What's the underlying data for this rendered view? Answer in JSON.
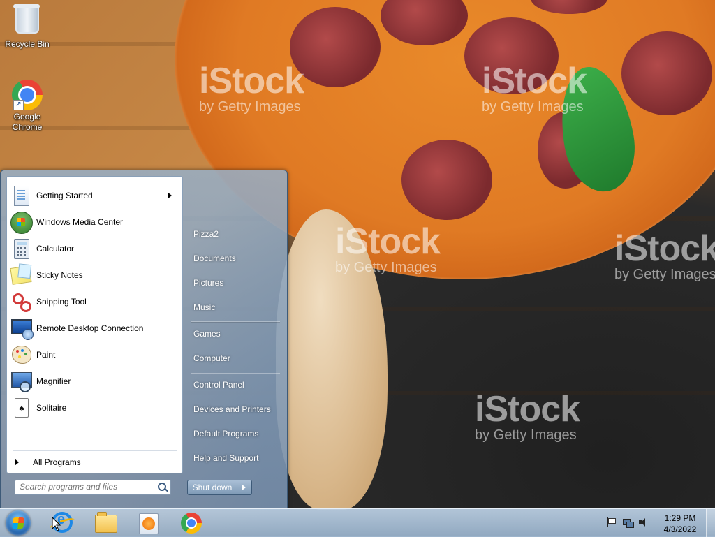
{
  "desktop": {
    "watermarks": [
      {
        "big": "iStock",
        "small": "by Getty Images"
      },
      {
        "big": "iStock",
        "small": "by Getty Images"
      },
      {
        "big": "iStock",
        "small": "by Getty Images"
      },
      {
        "big": "iStock",
        "small": "by Getty Images"
      },
      {
        "big": "iStock",
        "small": "by Getty Images"
      }
    ],
    "icons": [
      {
        "label": "Recycle Bin",
        "icon": "recycle-bin-icon"
      },
      {
        "label": "Google Chrome",
        "icon": "chrome-icon"
      }
    ]
  },
  "start_menu": {
    "programs": [
      {
        "label": "Getting Started",
        "icon": "getting-started-icon",
        "has_submenu": true
      },
      {
        "label": "Windows Media Center",
        "icon": "windows-media-center-icon"
      },
      {
        "label": "Calculator",
        "icon": "calculator-icon"
      },
      {
        "label": "Sticky Notes",
        "icon": "sticky-notes-icon"
      },
      {
        "label": "Snipping Tool",
        "icon": "snipping-tool-icon"
      },
      {
        "label": "Remote Desktop Connection",
        "icon": "remote-desktop-icon"
      },
      {
        "label": "Paint",
        "icon": "paint-icon"
      },
      {
        "label": "Magnifier",
        "icon": "magnifier-icon"
      },
      {
        "label": "Solitaire",
        "icon": "solitaire-icon"
      }
    ],
    "all_programs_label": "All Programs",
    "search_placeholder": "Search programs and files",
    "right_items": [
      "Pizza2",
      "Documents",
      "Pictures",
      "Music",
      "Games",
      "Computer",
      "Control Panel",
      "Devices and Printers",
      "Default Programs",
      "Help and Support"
    ],
    "shutdown_label": "Shut down"
  },
  "taskbar": {
    "pinned": [
      {
        "name": "Internet Explorer",
        "icon": "internet-explorer-icon"
      },
      {
        "name": "Windows Explorer",
        "icon": "folder-icon"
      },
      {
        "name": "Windows Media Player",
        "icon": "media-player-icon"
      },
      {
        "name": "Google Chrome",
        "icon": "chrome-icon"
      }
    ],
    "tray_icons": [
      "action-center-flag-icon",
      "network-icon",
      "volume-icon"
    ],
    "clock": {
      "time": "1:29 PM",
      "date": "4/3/2022"
    }
  }
}
